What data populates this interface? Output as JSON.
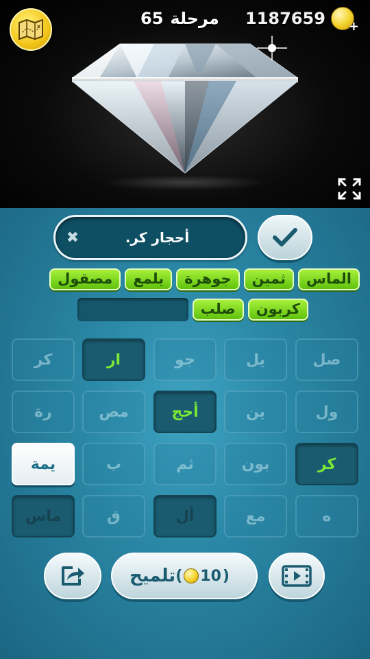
{
  "header": {
    "level_label": "مرحلة",
    "level_number": "65",
    "coins": "1187659"
  },
  "answer": {
    "text": "أحجار كر."
  },
  "found_words": {
    "row1": [
      "الماس",
      "ثمين",
      "جوهرة",
      "يلمع",
      "مصقول"
    ],
    "row2": [
      "كربون",
      "صلب"
    ]
  },
  "tiles": {
    "r1": [
      "صل",
      "يل",
      "جو",
      "ار",
      "كر"
    ],
    "r2": [
      "ول",
      "ين",
      "أحج",
      "مص",
      "رة"
    ],
    "r3": [
      "كر",
      "بون",
      "ثم",
      "ب",
      "يمة"
    ],
    "r4": [
      "ه",
      "مع",
      "أل",
      "ق",
      "ماس"
    ]
  },
  "hint": {
    "label": "تلميح",
    "cost": "10"
  },
  "icons": {
    "map": "treasure-map-icon",
    "coin": "coin-icon",
    "expand": "expand-icon",
    "check": "checkmark-icon",
    "clear": "close-icon",
    "share": "share-icon",
    "video": "video-film-icon"
  },
  "colors": {
    "panel": "#2a87a5",
    "found_green": "#7ed321",
    "used_text_green": "#7be836",
    "coin_gold": "#f3d12a"
  }
}
